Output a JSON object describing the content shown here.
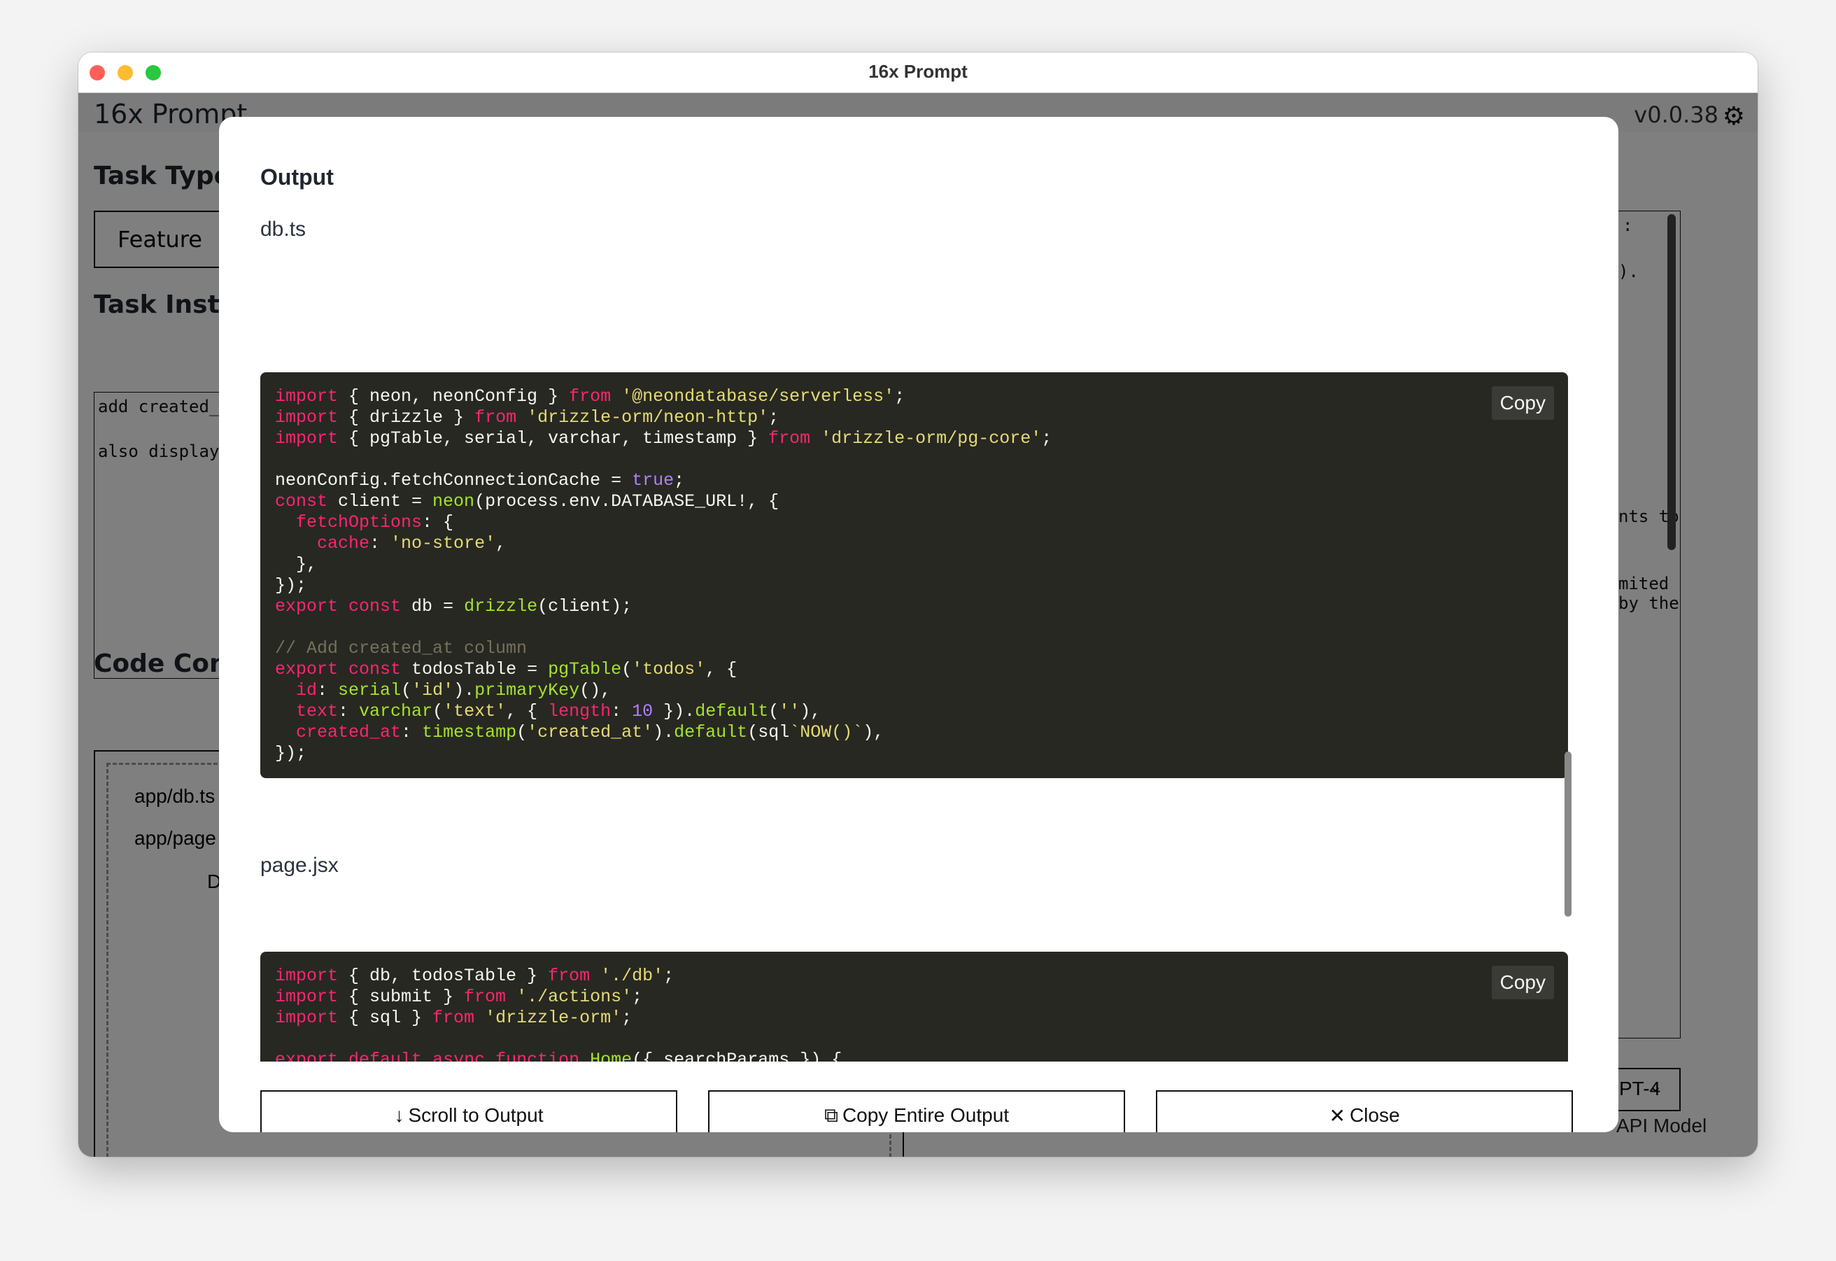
{
  "window": {
    "title": "16x Prompt",
    "traffic_lights": {
      "close": "#ff5f57",
      "minimize": "#febc2e",
      "maximize": "#28c840"
    }
  },
  "app": {
    "title": "16x Prompt",
    "version": "v0.0.38",
    "settings_icon": "gear-icon",
    "task_type_label": "Task Type",
    "task_type_value": "Feature",
    "task_instructions_label": "Task Instru",
    "task_instructions_lines": [
      "add created_",
      "also display"
    ],
    "code_context_label": "Code Con",
    "code_context_files": [
      "app/db.ts",
      "app/page",
      "D"
    ],
    "right_panel_lines": [
      ":",
      ").",
      "nts to",
      "mited by the"
    ],
    "model_select_value": "PT-4",
    "model_label": "API Model"
  },
  "modal": {
    "title": "Output",
    "copy_label": "Copy",
    "files": [
      {
        "name": "db.ts",
        "code": [
          [
            [
              "kw",
              "import"
            ],
            [
              "pl",
              " { neon, neonConfig } "
            ],
            [
              "kw",
              "from"
            ],
            [
              "pl",
              " "
            ],
            [
              "str",
              "'@neondatabase/serverless'"
            ],
            [
              "pl",
              ";"
            ]
          ],
          [
            [
              "kw",
              "import"
            ],
            [
              "pl",
              " { drizzle } "
            ],
            [
              "kw",
              "from"
            ],
            [
              "pl",
              " "
            ],
            [
              "str",
              "'drizzle-orm/neon-http'"
            ],
            [
              "pl",
              ";"
            ]
          ],
          [
            [
              "kw",
              "import"
            ],
            [
              "pl",
              " { pgTable, serial, varchar, timestamp } "
            ],
            [
              "kw",
              "from"
            ],
            [
              "pl",
              " "
            ],
            [
              "str",
              "'drizzle-orm/pg-core'"
            ],
            [
              "pl",
              ";"
            ]
          ],
          [],
          [
            [
              "pl",
              "neonConfig.fetchConnectionCache = "
            ],
            [
              "num",
              "true"
            ],
            [
              "pl",
              ";"
            ]
          ],
          [
            [
              "kw",
              "const"
            ],
            [
              "pl",
              " client = "
            ],
            [
              "fn",
              "neon"
            ],
            [
              "pl",
              "(process.env.DATABASE_URL!, {"
            ]
          ],
          [
            [
              "pl",
              "  "
            ],
            [
              "kw",
              "fetchOptions"
            ],
            [
              "pl",
              ": {"
            ]
          ],
          [
            [
              "pl",
              "    "
            ],
            [
              "kw",
              "cache"
            ],
            [
              "pl",
              ": "
            ],
            [
              "str",
              "'no-store'"
            ],
            [
              "pl",
              ","
            ]
          ],
          [
            [
              "pl",
              "  },"
            ]
          ],
          [
            [
              "pl",
              "});"
            ]
          ],
          [
            [
              "kw",
              "export"
            ],
            [
              "pl",
              " "
            ],
            [
              "kw",
              "const"
            ],
            [
              "pl",
              " db = "
            ],
            [
              "fn",
              "drizzle"
            ],
            [
              "pl",
              "(client);"
            ]
          ],
          [],
          [
            [
              "cm",
              "// Add created_at column"
            ]
          ],
          [
            [
              "kw",
              "export"
            ],
            [
              "pl",
              " "
            ],
            [
              "kw",
              "const"
            ],
            [
              "pl",
              " todosTable = "
            ],
            [
              "fn",
              "pgTable"
            ],
            [
              "pl",
              "("
            ],
            [
              "str",
              "'todos'"
            ],
            [
              "pl",
              ", {"
            ]
          ],
          [
            [
              "pl",
              "  "
            ],
            [
              "kw",
              "id"
            ],
            [
              "pl",
              ": "
            ],
            [
              "fn",
              "serial"
            ],
            [
              "pl",
              "("
            ],
            [
              "str",
              "'id'"
            ],
            [
              "pl",
              ")."
            ],
            [
              "fn",
              "primaryKey"
            ],
            [
              "pl",
              "(),"
            ]
          ],
          [
            [
              "pl",
              "  "
            ],
            [
              "kw",
              "text"
            ],
            [
              "pl",
              ": "
            ],
            [
              "fn",
              "varchar"
            ],
            [
              "pl",
              "("
            ],
            [
              "str",
              "'text'"
            ],
            [
              "pl",
              ", { "
            ],
            [
              "kw",
              "length"
            ],
            [
              "pl",
              ": "
            ],
            [
              "num",
              "10"
            ],
            [
              "pl",
              " })."
            ],
            [
              "fn",
              "default"
            ],
            [
              "pl",
              "("
            ],
            [
              "str",
              "''"
            ],
            [
              "pl",
              "),"
            ]
          ],
          [
            [
              "pl",
              "  "
            ],
            [
              "kw",
              "created_at"
            ],
            [
              "pl",
              ": "
            ],
            [
              "fn",
              "timestamp"
            ],
            [
              "pl",
              "("
            ],
            [
              "str",
              "'created_at'"
            ],
            [
              "pl",
              ")."
            ],
            [
              "fn",
              "default"
            ],
            [
              "pl",
              "(sql"
            ],
            [
              "str",
              "`NOW()`"
            ],
            [
              "pl",
              "),"
            ]
          ],
          [
            [
              "pl",
              "});"
            ]
          ]
        ]
      },
      {
        "name": "page.jsx",
        "code": [
          [
            [
              "kw",
              "import"
            ],
            [
              "pl",
              " { db, todosTable } "
            ],
            [
              "kw",
              "from"
            ],
            [
              "pl",
              " "
            ],
            [
              "str",
              "'./db'"
            ],
            [
              "pl",
              ";"
            ]
          ],
          [
            [
              "kw",
              "import"
            ],
            [
              "pl",
              " { submit } "
            ],
            [
              "kw",
              "from"
            ],
            [
              "pl",
              " "
            ],
            [
              "str",
              "'./actions'"
            ],
            [
              "pl",
              ";"
            ]
          ],
          [
            [
              "kw",
              "import"
            ],
            [
              "pl",
              " { sql } "
            ],
            [
              "kw",
              "from"
            ],
            [
              "pl",
              " "
            ],
            [
              "str",
              "'drizzle-orm'"
            ],
            [
              "pl",
              ";"
            ]
          ],
          [],
          [
            [
              "kw",
              "export"
            ],
            [
              "pl",
              " "
            ],
            [
              "kw",
              "default"
            ],
            [
              "pl",
              " "
            ],
            [
              "kw",
              "async"
            ],
            [
              "pl",
              " "
            ],
            [
              "kw",
              "function"
            ],
            [
              "pl",
              " "
            ],
            [
              "fn",
              "Home"
            ],
            [
              "pl",
              "({ searchParams }) {"
            ]
          ]
        ]
      }
    ],
    "buttons": {
      "scroll_to_output": {
        "icon": "arrow-down-icon",
        "label": "Scroll to Output"
      },
      "copy_entire_output": {
        "icon": "copy-icon",
        "label": "Copy Entire Output"
      },
      "close": {
        "icon": "close-icon",
        "label": "Close"
      }
    }
  }
}
